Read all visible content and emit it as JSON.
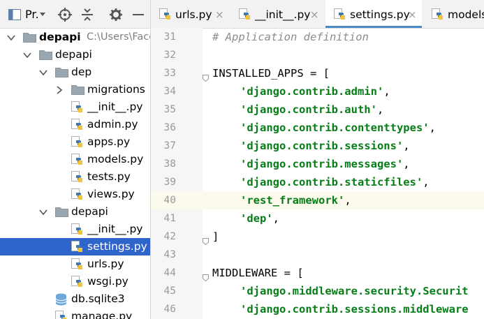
{
  "project_panel": {
    "title": "Pr.",
    "tree": [
      {
        "label": "depapi",
        "path": "C:\\Users\\Face",
        "kind": "folder",
        "expanded": true,
        "depth": 0,
        "bold": true
      },
      {
        "label": "depapi",
        "kind": "folder",
        "expanded": true,
        "depth": 1
      },
      {
        "label": "dep",
        "kind": "folder",
        "expanded": true,
        "depth": 2
      },
      {
        "label": "migrations",
        "kind": "folder",
        "expanded": false,
        "depth": 3
      },
      {
        "label": "__init__.py",
        "kind": "python-file",
        "depth": 3
      },
      {
        "label": "admin.py",
        "kind": "python-file",
        "depth": 3
      },
      {
        "label": "apps.py",
        "kind": "python-file",
        "depth": 3
      },
      {
        "label": "models.py",
        "kind": "python-file",
        "depth": 3
      },
      {
        "label": "tests.py",
        "kind": "python-file",
        "depth": 3
      },
      {
        "label": "views.py",
        "kind": "python-file",
        "depth": 3
      },
      {
        "label": "depapi",
        "kind": "folder",
        "expanded": true,
        "depth": 2
      },
      {
        "label": "__init__.py",
        "kind": "python-file",
        "depth": 3
      },
      {
        "label": "settings.py",
        "kind": "python-file",
        "depth": 3,
        "selected": true
      },
      {
        "label": "urls.py",
        "kind": "python-file",
        "depth": 3
      },
      {
        "label": "wsgi.py",
        "kind": "python-file",
        "depth": 3
      },
      {
        "label": "db.sqlite3",
        "kind": "database-file",
        "depth": 2
      },
      {
        "label": "manage.py",
        "kind": "python-file",
        "depth": 2
      }
    ]
  },
  "tabs": [
    {
      "label": "urls.py",
      "close": "×",
      "active": false
    },
    {
      "label": "__init__.py",
      "close": "×",
      "active": false
    },
    {
      "label": "settings.py",
      "close": "×",
      "active": true
    },
    {
      "label": "models.py",
      "close": "×",
      "active": false
    }
  ],
  "code_lines": [
    {
      "n": "31",
      "text": "# Application definition",
      "type": "comment"
    },
    {
      "n": "32",
      "text": "",
      "type": "plain"
    },
    {
      "n": "33",
      "text": "INSTALLED_APPS = [",
      "type": "plain",
      "fold": true
    },
    {
      "n": "34",
      "str": "'django.contrib.admin'",
      "suffix": ",",
      "type": "string"
    },
    {
      "n": "35",
      "str": "'django.contrib.auth'",
      "suffix": ",",
      "type": "string"
    },
    {
      "n": "36",
      "str": "'django.contrib.contenttypes'",
      "suffix": ",",
      "type": "string"
    },
    {
      "n": "37",
      "str": "'django.contrib.sessions'",
      "suffix": ",",
      "type": "string"
    },
    {
      "n": "38",
      "str": "'django.contrib.messages'",
      "suffix": ",",
      "type": "string"
    },
    {
      "n": "39",
      "str": "'django.contrib.staticfiles'",
      "suffix": ",",
      "type": "string"
    },
    {
      "n": "40",
      "str": "'rest_framework'",
      "suffix": ",",
      "type": "string",
      "current": true
    },
    {
      "n": "41",
      "str": "'dep'",
      "suffix": ",",
      "type": "string"
    },
    {
      "n": "42",
      "text": "]",
      "type": "plain",
      "fold": true
    },
    {
      "n": "43",
      "text": "",
      "type": "plain"
    },
    {
      "n": "44",
      "text": "MIDDLEWARE = [",
      "type": "plain",
      "fold": true
    },
    {
      "n": "45",
      "str": "'django.middleware.security.Securit",
      "suffix": "",
      "type": "string"
    },
    {
      "n": "46",
      "str": "'django.contrib.sessions.middleware",
      "suffix": "",
      "type": "string"
    }
  ],
  "colors": {
    "selection": "#2f65ca",
    "string": "#067d17",
    "comment": "#8c8c8c",
    "current_line": "#fcfaed",
    "active_tab_underline": "#4a88c7"
  }
}
